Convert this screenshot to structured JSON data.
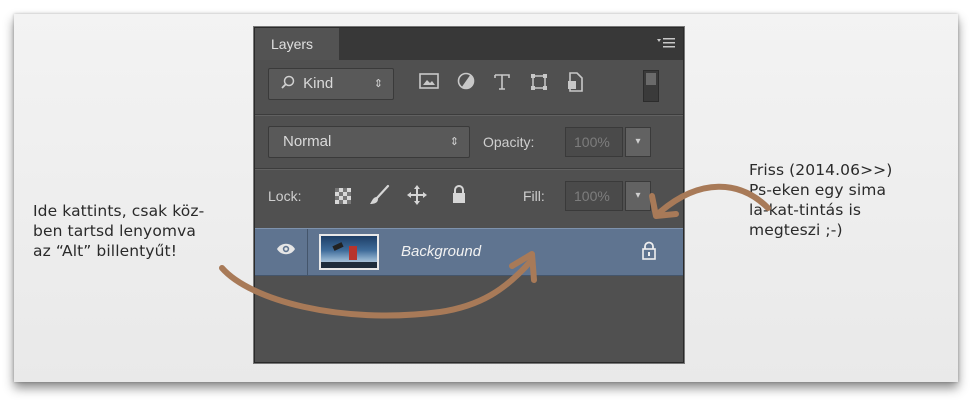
{
  "notes": {
    "left": [
      "Ide kattints, csak köz-",
      "ben tartsd lenyomva",
      "az “Alt” billentyűt!"
    ],
    "right": [
      "Friss (2014.06>>)",
      "Ps-eken egy sima",
      "la-kat-tintás is",
      "megteszi ;-)"
    ]
  },
  "panel": {
    "tab_label": "Layers",
    "menu_icon": "≡",
    "filter": {
      "kind_label": "Kind",
      "kind_search_icon": "⌕",
      "kind_arrows": "⇕",
      "icons": [
        "image-filter-icon",
        "adjustment-filter-icon",
        "type-filter-icon",
        "shape-filter-icon",
        "smart-object-filter-icon"
      ]
    },
    "blend": {
      "mode": "Normal",
      "arrows": "⇕",
      "opacity_label": "Opacity:",
      "opacity_value": "100%",
      "dropdown_glyph": "▾"
    },
    "lock": {
      "label": "Lock:",
      "fill_label": "Fill:",
      "fill_value": "100%",
      "dropdown_glyph": "▾"
    },
    "layer": {
      "name": "Background",
      "visible_icon": "👁",
      "lock_icon": "🔒"
    }
  },
  "colors": {
    "panel_bg": "#505050",
    "selected_layer": "#5f7490",
    "arrow": "#a87a58"
  }
}
